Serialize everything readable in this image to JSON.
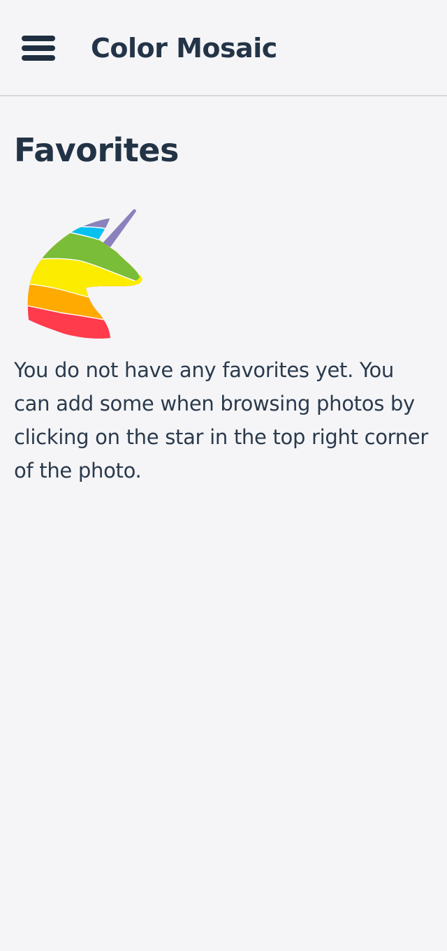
{
  "header": {
    "title": "Color Mosaic",
    "menu_icon": "hamburger-menu-icon"
  },
  "page": {
    "title": "Favorites",
    "illustration_icon": "rainbow-unicorn-icon",
    "empty_message": "You do not have any favorites yet. You can add some when browsing photos by clicking on the star in the top right corner of the photo."
  },
  "colors": {
    "background": "#f5f5f7",
    "text": "#223346",
    "divider": "#d8d8dc",
    "unicorn_stripes": [
      "#8a82bc",
      "#05c1f0",
      "#79bd38",
      "#fcec00",
      "#ffaa00",
      "#ff3b4c"
    ]
  }
}
